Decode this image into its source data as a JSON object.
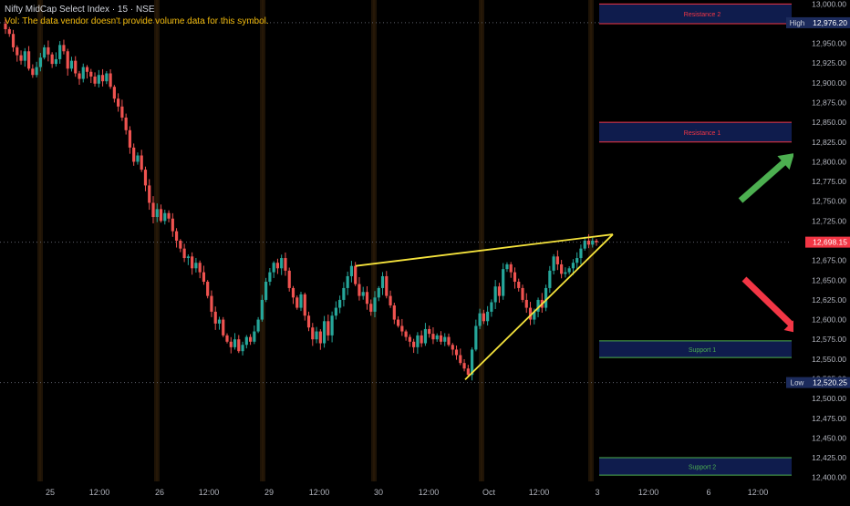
{
  "header": {
    "title": "Nifty MidCap Select Index · 15 · NSE",
    "vol_note": "Vol: The data vendor doesn't provide volume data for this symbol."
  },
  "colors": {
    "background": "#000000",
    "up": "#26a69a",
    "down": "#ef5350",
    "wedge": "#f5e33c",
    "resistance": "#f23645",
    "support": "#4caf50",
    "zone_fill": "#0f1c4d",
    "arrow_up": "#4caf50",
    "arrow_down": "#f23645",
    "axis_text": "#b2b5be"
  },
  "chart_data": {
    "type": "candlestick",
    "ylim": [
      12395,
      13005
    ],
    "y_ticks": [
      "13,000.00",
      "12,975.00",
      "12,950.00",
      "12,925.00",
      "12,900.00",
      "12,875.00",
      "12,850.00",
      "12,825.00",
      "12,800.00",
      "12,775.00",
      "12,750.00",
      "12,725.00",
      "12,700.00",
      "12,675.00",
      "12,650.00",
      "12,625.00",
      "12,600.00",
      "12,575.00",
      "12,550.00",
      "12,525.00",
      "12,500.00",
      "12,475.00",
      "12,450.00",
      "12,425.00",
      "12,400.00"
    ],
    "x_labels": [
      "25",
      "12:00",
      "26",
      "12:00",
      "29",
      "12:00",
      "30",
      "12:00",
      "Oct",
      "12:00",
      "3",
      "12:00",
      "6",
      "12:00"
    ],
    "price_tags": [
      {
        "label": "High",
        "value": "12,976.20",
        "price": 12976.2
      },
      {
        "label": "",
        "value": "12,698.15",
        "price": 12698.15
      },
      {
        "label": "Low",
        "value": "12,520.25",
        "price": 12520.25
      }
    ],
    "zones": [
      {
        "label": "Resistance 2",
        "top": 13000,
        "bottom": 12975,
        "kind": "resistance"
      },
      {
        "label": "Resistance 1",
        "top": 12850,
        "bottom": 12825,
        "kind": "resistance"
      },
      {
        "label": "Support 1",
        "top": 12573,
        "bottom": 12552,
        "kind": "support"
      },
      {
        "label": "Support 2",
        "top": 12425,
        "bottom": 12403,
        "kind": "support"
      }
    ],
    "wedge": {
      "upper": [
        [
          12668,
          0
        ],
        [
          12708,
          1
        ]
      ],
      "lower": [
        [
          12524,
          0
        ],
        [
          12708,
          1
        ]
      ]
    },
    "series": {
      "closes": [
        12968,
        12962,
        12945,
        12935,
        12928,
        12940,
        12918,
        12910,
        12920,
        12932,
        12945,
        12936,
        12924,
        12930,
        12948,
        12940,
        12918,
        12928,
        12912,
        12905,
        12920,
        12914,
        12908,
        12899,
        12910,
        12902,
        12912,
        12895,
        12880,
        12870,
        12856,
        12840,
        12818,
        12800,
        12808,
        12790,
        12770,
        12748,
        12730,
        12740,
        12725,
        12735,
        12728,
        12712,
        12700,
        12690,
        12678,
        12680,
        12665,
        12672,
        12660,
        12648,
        12630,
        12610,
        12595,
        12600,
        12580,
        12572,
        12565,
        12575,
        12560,
        12568,
        12578,
        12572,
        12585,
        12600,
        12625,
        12648,
        12660,
        12672,
        12665,
        12678,
        12662,
        12640,
        12628,
        12615,
        12632,
        12605,
        12590,
        12575,
        12585,
        12570,
        12598,
        12580,
        12605,
        12615,
        12625,
        12640,
        12655,
        12668,
        12645,
        12630,
        12635,
        12620,
        12610,
        12628,
        12640,
        12655,
        12630,
        12618,
        12600,
        12592,
        12585,
        12578,
        12572,
        12565,
        12580,
        12570,
        12588,
        12582,
        12575,
        12580,
        12572,
        12578,
        12568,
        12562,
        12555,
        12545,
        12538,
        12530,
        12562,
        12592,
        12608,
        12598,
        12610,
        12622,
        12642,
        12630,
        12664,
        12670,
        12660,
        12648,
        12640,
        12625,
        12615,
        12600,
        12610,
        12625,
        12615,
        12640,
        12662,
        12680,
        12670,
        12658,
        12660,
        12665,
        12672,
        12678,
        12690,
        12700,
        12695,
        12700,
        12698
      ]
    }
  }
}
